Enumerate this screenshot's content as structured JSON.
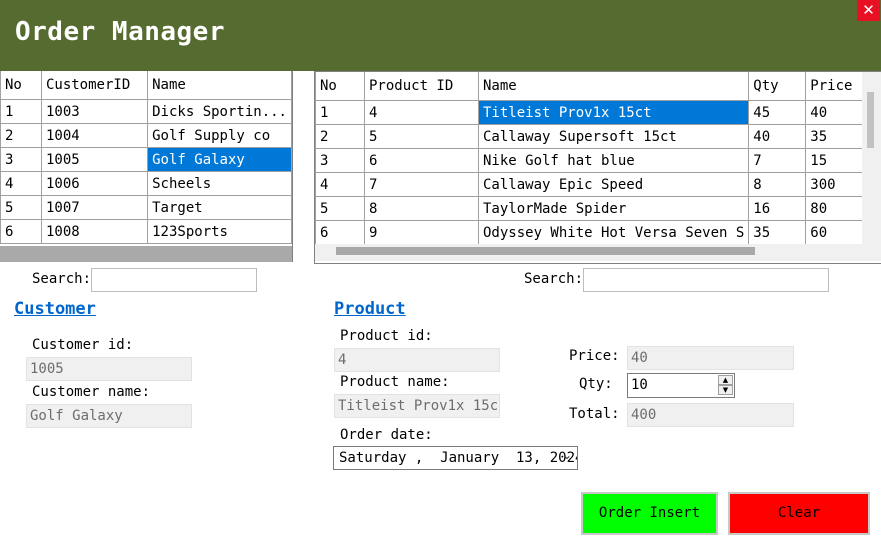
{
  "window": {
    "title": "Order Manager",
    "close_glyph": "✕"
  },
  "customer_grid": {
    "columns": [
      "No",
      "CustomerID",
      "Name"
    ],
    "rows": [
      [
        "1",
        "1003",
        "Dicks Sportin..."
      ],
      [
        "2",
        "1004",
        "Golf Supply co"
      ],
      [
        "3",
        "1005",
        "Golf Galaxy"
      ],
      [
        "4",
        "1006",
        "Scheels"
      ],
      [
        "5",
        "1007",
        "Target"
      ],
      [
        "6",
        "1008",
        "123Sports"
      ]
    ],
    "selected_row": 2
  },
  "product_grid": {
    "columns": [
      "No",
      "Product ID",
      "Name",
      "Qty",
      "Price"
    ],
    "rows": [
      [
        "1",
        "4",
        "Titleist Prov1x 15ct",
        "45",
        "40"
      ],
      [
        "2",
        "5",
        "Callaway Supersoft 15ct",
        "40",
        "35"
      ],
      [
        "3",
        "6",
        "Nike Golf hat blue",
        "7",
        "15"
      ],
      [
        "4",
        "7",
        "Callaway Epic Speed",
        "8",
        "300"
      ],
      [
        "5",
        "8",
        "TaylorMade Spider",
        "16",
        "80"
      ],
      [
        "6",
        "9",
        "Odyssey White Hot Versa Seven S",
        "35",
        "60"
      ]
    ],
    "selected_row": 0
  },
  "customer_search": {
    "label": "Search:",
    "value": ""
  },
  "product_search": {
    "label": "Search:",
    "value": ""
  },
  "customer_section": {
    "title": "Customer",
    "id_label": "Customer id:",
    "id_value": "1005",
    "name_label": "Customer name:",
    "name_value": "Golf Galaxy"
  },
  "product_section": {
    "title": "Product",
    "id_label": "Product id:",
    "id_value": "4",
    "name_label": "Product name:",
    "name_value": "Titleist Prov1x 15ct",
    "order_date_label": "Order date:",
    "order_date_value": "Saturday ,  January  13, 2024",
    "price_label": "Price:",
    "price_value": "40",
    "qty_label": "Qty:",
    "qty_value": "10",
    "total_label": "Total:",
    "total_value": "400"
  },
  "buttons": {
    "order_insert": "Order Insert",
    "clear": "Clear"
  },
  "colors": {
    "header_bg": "#556b2f",
    "selection": "#0078d7",
    "section_link": "#0066cc",
    "order_insert_bg": "#00ff00",
    "clear_bg": "#ff0000",
    "close_bg": "#e81123"
  }
}
